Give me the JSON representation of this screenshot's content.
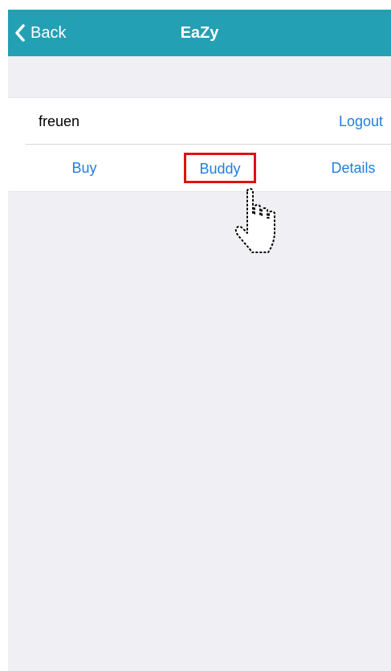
{
  "navbar": {
    "back_label": "Back",
    "title": "EaZy",
    "color": "#24a0b4",
    "back_icon": "chevron-left-icon"
  },
  "account": {
    "username": "freuen",
    "logout_label": "Logout"
  },
  "tabs": [
    {
      "label": "Buy"
    },
    {
      "label": "Buddy",
      "highlighted": true
    },
    {
      "label": "Details"
    }
  ],
  "highlight_color": "#e01010",
  "link_color": "#1f7fe0",
  "cursor": {
    "icon": "pointer-hand-icon"
  }
}
